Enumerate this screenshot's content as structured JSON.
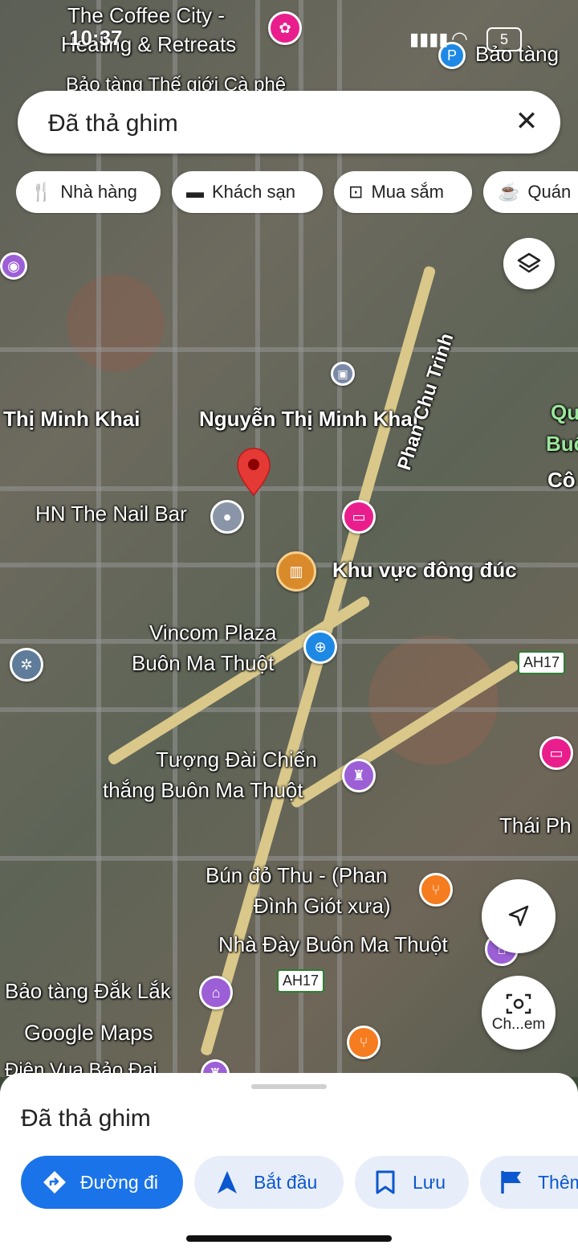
{
  "status_bar": {
    "time": "10:37",
    "battery": "5"
  },
  "search": {
    "value": "Đã thả ghim"
  },
  "chips": [
    {
      "icon": "restaurant-icon",
      "label": "Nhà hàng"
    },
    {
      "icon": "hotel-icon",
      "label": "Khách sạn"
    },
    {
      "icon": "shopping-icon",
      "label": "Mua sắm"
    },
    {
      "icon": "cafe-icon",
      "label": "Quán"
    }
  ],
  "map_labels": {
    "coffee_city": "The Coffee City - Healing & Retreats",
    "coffee_city_1": "The Coffee City -",
    "coffee_city_2": "Healing & Retreats",
    "bao_tang_top": "Bảo tàng",
    "bao_tang_cafe": "Bảo tàng Thế giới Cà phê",
    "minh_khai_left": "Thị Minh Khai",
    "minh_khai": "Nguyễn Thị Minh Khai",
    "phan_chu_trinh": "Phan Chu Trinh",
    "right_q": "Qu",
    "right_buc": "Buô",
    "right_co": "Cô",
    "nail_bar": "HN The Nail Bar",
    "crowded": "Khu vực đông đúc",
    "vincom_1": "Vincom Plaza",
    "vincom_2": "Buôn Ma Thuột",
    "ah17_a": "AH17",
    "tuong_dai_1": "Tượng Đài Chiến",
    "tuong_dai_2": "thắng Buôn Ma Thuột",
    "thai_ph": "Thái Ph",
    "bun_do_1": "Bún đỏ Thu - (Phan",
    "bun_do_2": "Đình Giót xưa)",
    "nha_day": "Nhà Đày Buôn Ma Thuột",
    "ah17_b": "AH17",
    "bao_tang_daklak": "Bảo tàng Đắk Lắk",
    "google_maps": "Google Maps",
    "dien_vu": "Điện Vua Bảo Đại"
  },
  "fabs": {
    "recenter_label": "Ch...em"
  },
  "sheet": {
    "title": "Đã thả ghim",
    "actions": [
      {
        "label": "Đường đi",
        "icon": "directions-icon"
      },
      {
        "label": "Bắt đầu",
        "icon": "navigation-icon"
      },
      {
        "label": "Lưu",
        "icon": "bookmark-icon"
      },
      {
        "label": "Thêm",
        "icon": "flag-icon"
      }
    ]
  },
  "colors": {
    "primary": "#1a73e8",
    "pin": "#e53935",
    "poi_pink": "#e91e8c",
    "poi_purple": "#9c5fd6",
    "poi_orange": "#f57c1f",
    "poi_blue": "#1e88e5"
  }
}
